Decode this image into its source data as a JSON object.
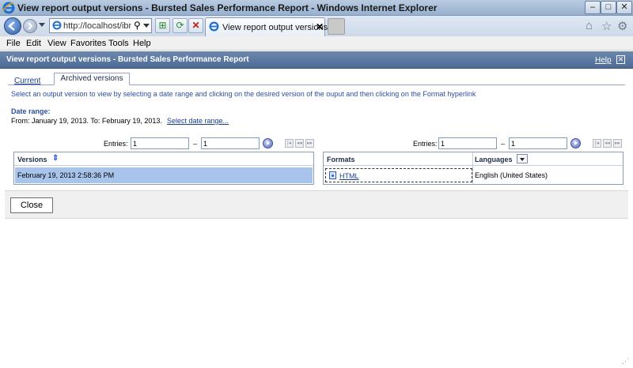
{
  "window": {
    "title": "View report output versions - Bursted Sales Performance Report - Windows Internet Explorer",
    "minimize": "–",
    "maximize": "□",
    "close": "✕"
  },
  "browser": {
    "url": "http://localhost/ibmcog",
    "tab_title": "View report output versions ...",
    "tab_close": "✕"
  },
  "menu": {
    "items": [
      "File",
      "Edit",
      "View",
      "Favorites",
      "Tools",
      "Help"
    ]
  },
  "header": {
    "title": "View report output versions - Bursted Sales Performance Report",
    "help": "Help"
  },
  "tabs": {
    "current": "Current",
    "archived": "Archived versions"
  },
  "instructions": "Select an output version to view by selecting a date range and clicking on the desired version of the ouput and then clicking on the Format hyperlink",
  "date_range": {
    "heading": "Date range:",
    "text": "From: January 19, 2013. To: February 19, 2013.",
    "link": "Select date range..."
  },
  "versions_pager": {
    "label": "Entries:",
    "from": "1",
    "dash": "–",
    "to": "1"
  },
  "formats_pager": {
    "label": "Entries:",
    "from": "1",
    "dash": "–",
    "to": "1"
  },
  "versions": {
    "header": "Versions",
    "rows": [
      "February 19, 2013 2:58:36 PM"
    ]
  },
  "formats": {
    "formats_header": "Formats",
    "languages_header": "Languages",
    "format": "HTML",
    "language": "English (United States)"
  },
  "footer": {
    "close": "Close"
  }
}
